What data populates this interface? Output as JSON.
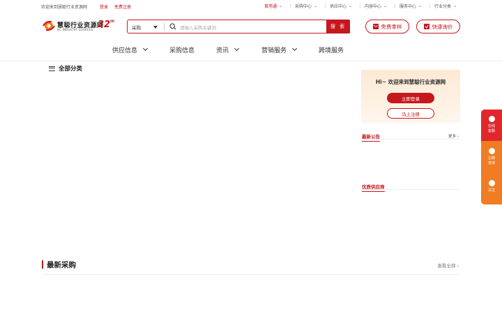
{
  "topbar": {
    "welcome": "欢迎来到慧聪行业资源网",
    "login": "登录",
    "register": "免费注册",
    "nav": [
      {
        "label": "首用通"
      },
      {
        "label": "采购中心"
      },
      {
        "label": "供应中心"
      },
      {
        "label": "内容中心"
      },
      {
        "label": "服务中心"
      },
      {
        "label": "行业分类"
      }
    ]
  },
  "logo": {
    "name_cn": "慧聪行业资源网",
    "name_en": "HC INDUSTRY SOURCES",
    "anniversary": "32",
    "anniversary_suffix": "th"
  },
  "search": {
    "category": "采购",
    "placeholder": "请输入采购关键词",
    "button": "搜 索"
  },
  "header_buttons": {
    "free_sample": "免费拿样",
    "quick_inquiry": "快速询价"
  },
  "mainnav": [
    {
      "label": "供应信息",
      "dropdown": true
    },
    {
      "label": "采购信息",
      "dropdown": false
    },
    {
      "label": "资讯",
      "dropdown": true
    },
    {
      "label": "营销服务",
      "dropdown": true
    },
    {
      "label": "跨境服务",
      "dropdown": false
    }
  ],
  "all_categories": "全部分类",
  "welcome_card": {
    "greeting": "Hi~ 欢迎来到慧聪行业资源网",
    "login_button": "立即登录",
    "register_button": "马上注册"
  },
  "news": {
    "title": "最新公告",
    "more": "更多"
  },
  "suppliers": {
    "title": "优质供应商"
  },
  "floatbar": [
    {
      "line1": "在线",
      "line2": "客服",
      "icon": "headset-icon"
    },
    {
      "line1": "企微",
      "line2": "咨询",
      "icon": "chat-icon"
    },
    {
      "line1": "关注",
      "line2": "",
      "icon": "wechat-icon"
    }
  ],
  "latest": {
    "title": "最新采购",
    "view_all": "查看全部"
  },
  "colors": {
    "brand_red": "#c8161d",
    "float_orange": "#f07c23",
    "float_red": "#e0272b"
  }
}
